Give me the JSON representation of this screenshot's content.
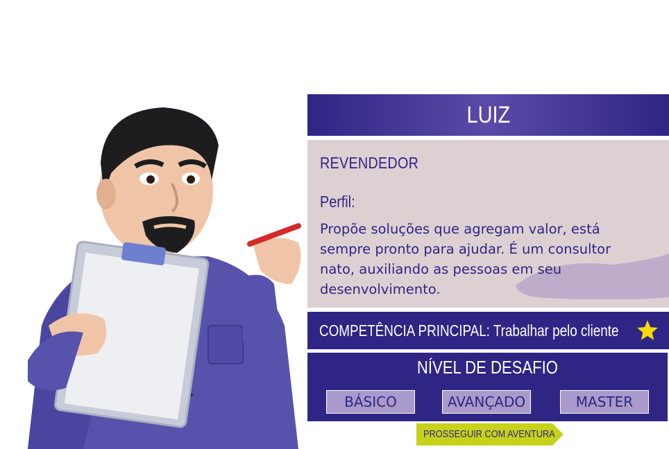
{
  "character": {
    "name": "LUIZ",
    "role": "REVENDEDOR",
    "profile_label": "Perfil:",
    "profile_text": "Propõe soluções que agregam valor, está sempre pronto para ajudar. É um consultor nato, auxiliando as pessoas em seu desenvolvimento.",
    "competence": "COMPETÊNCIA PRINCIPAL: Trabalhar pelo cliente",
    "competence_icon": "star-icon"
  },
  "challenge": {
    "title": "NÍVEL DE DESAFIO",
    "levels": [
      "BÁSICO",
      "AVANÇADO",
      "MASTER"
    ]
  },
  "proceed_label": "PROSSEGUIR COM AVENTURA",
  "colors": {
    "primary": "#2f2585",
    "card_bg": "#ddd0d3",
    "button_bg": "#a99acb",
    "proceed_bg": "#c7d21a",
    "star": "#f5d90a"
  }
}
